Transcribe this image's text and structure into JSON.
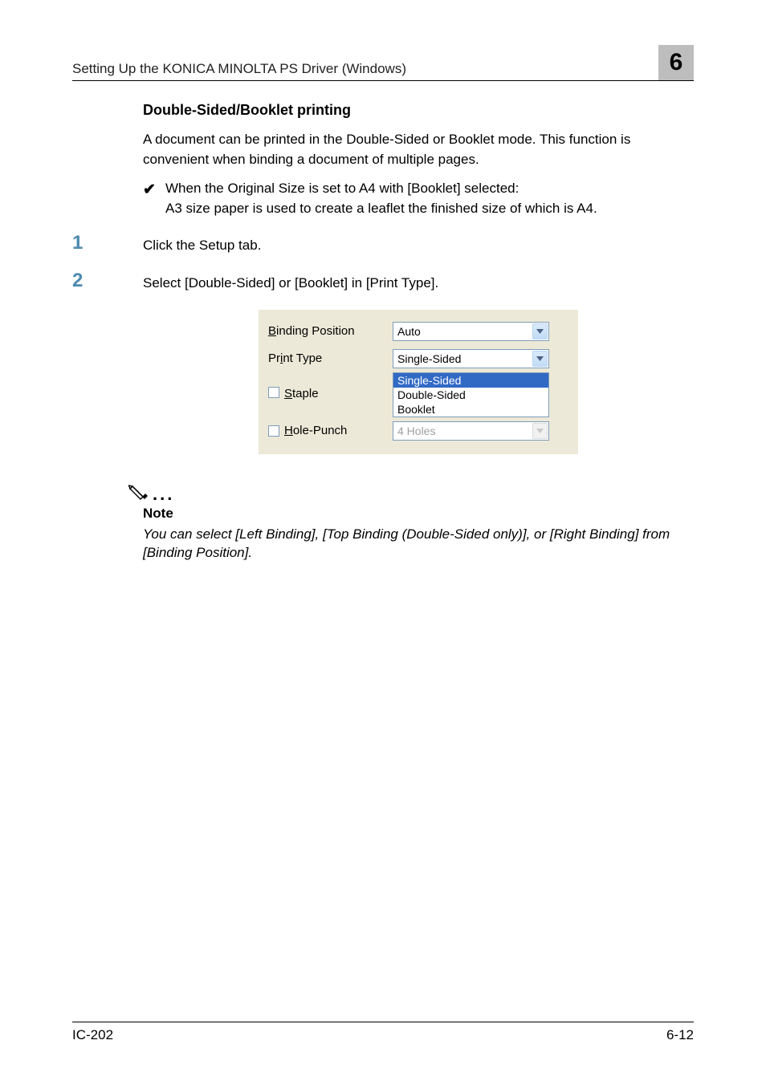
{
  "header": {
    "left": "Setting Up the KONICA MINOLTA PS Driver (Windows)",
    "chapter": "6"
  },
  "section": {
    "heading": "Double-Sided/Booklet printing",
    "paragraph": "A document can be printed in the Double-Sided or Booklet mode. This function is convenient when binding a document of multiple pages.",
    "check_line1": "When the Original Size is set to A4 with [Booklet] selected:",
    "check_line2": "A3 size paper is used to create a leaflet the finished size of which is A4."
  },
  "steps": {
    "1": {
      "num": "1",
      "text": "Click the Setup tab."
    },
    "2": {
      "num": "2",
      "text": "Select [Double-Sided] or [Booklet] in [Print Type]."
    }
  },
  "panel": {
    "binding_label_pre": "B",
    "binding_label_rest": "inding Position",
    "binding_value": "Auto",
    "print_pre": "Pr",
    "print_mid": "i",
    "print_rest": "nt Type",
    "print_value": "Single-Sided",
    "listbox": {
      "opt1": "Single-Sided",
      "opt2": "Double-Sided",
      "opt3": "Booklet"
    },
    "staple_pre": "S",
    "staple_rest": "taple",
    "hole_pre": "H",
    "hole_rest": "ole-Punch",
    "hole_value": "4 Holes"
  },
  "note": {
    "dots": "...",
    "label": "Note",
    "text": "You can select [Left Binding], [Top Binding (Double-Sided only)], or [Right Binding] from [Binding Position]."
  },
  "footer": {
    "left": "IC-202",
    "right": "6-12"
  }
}
